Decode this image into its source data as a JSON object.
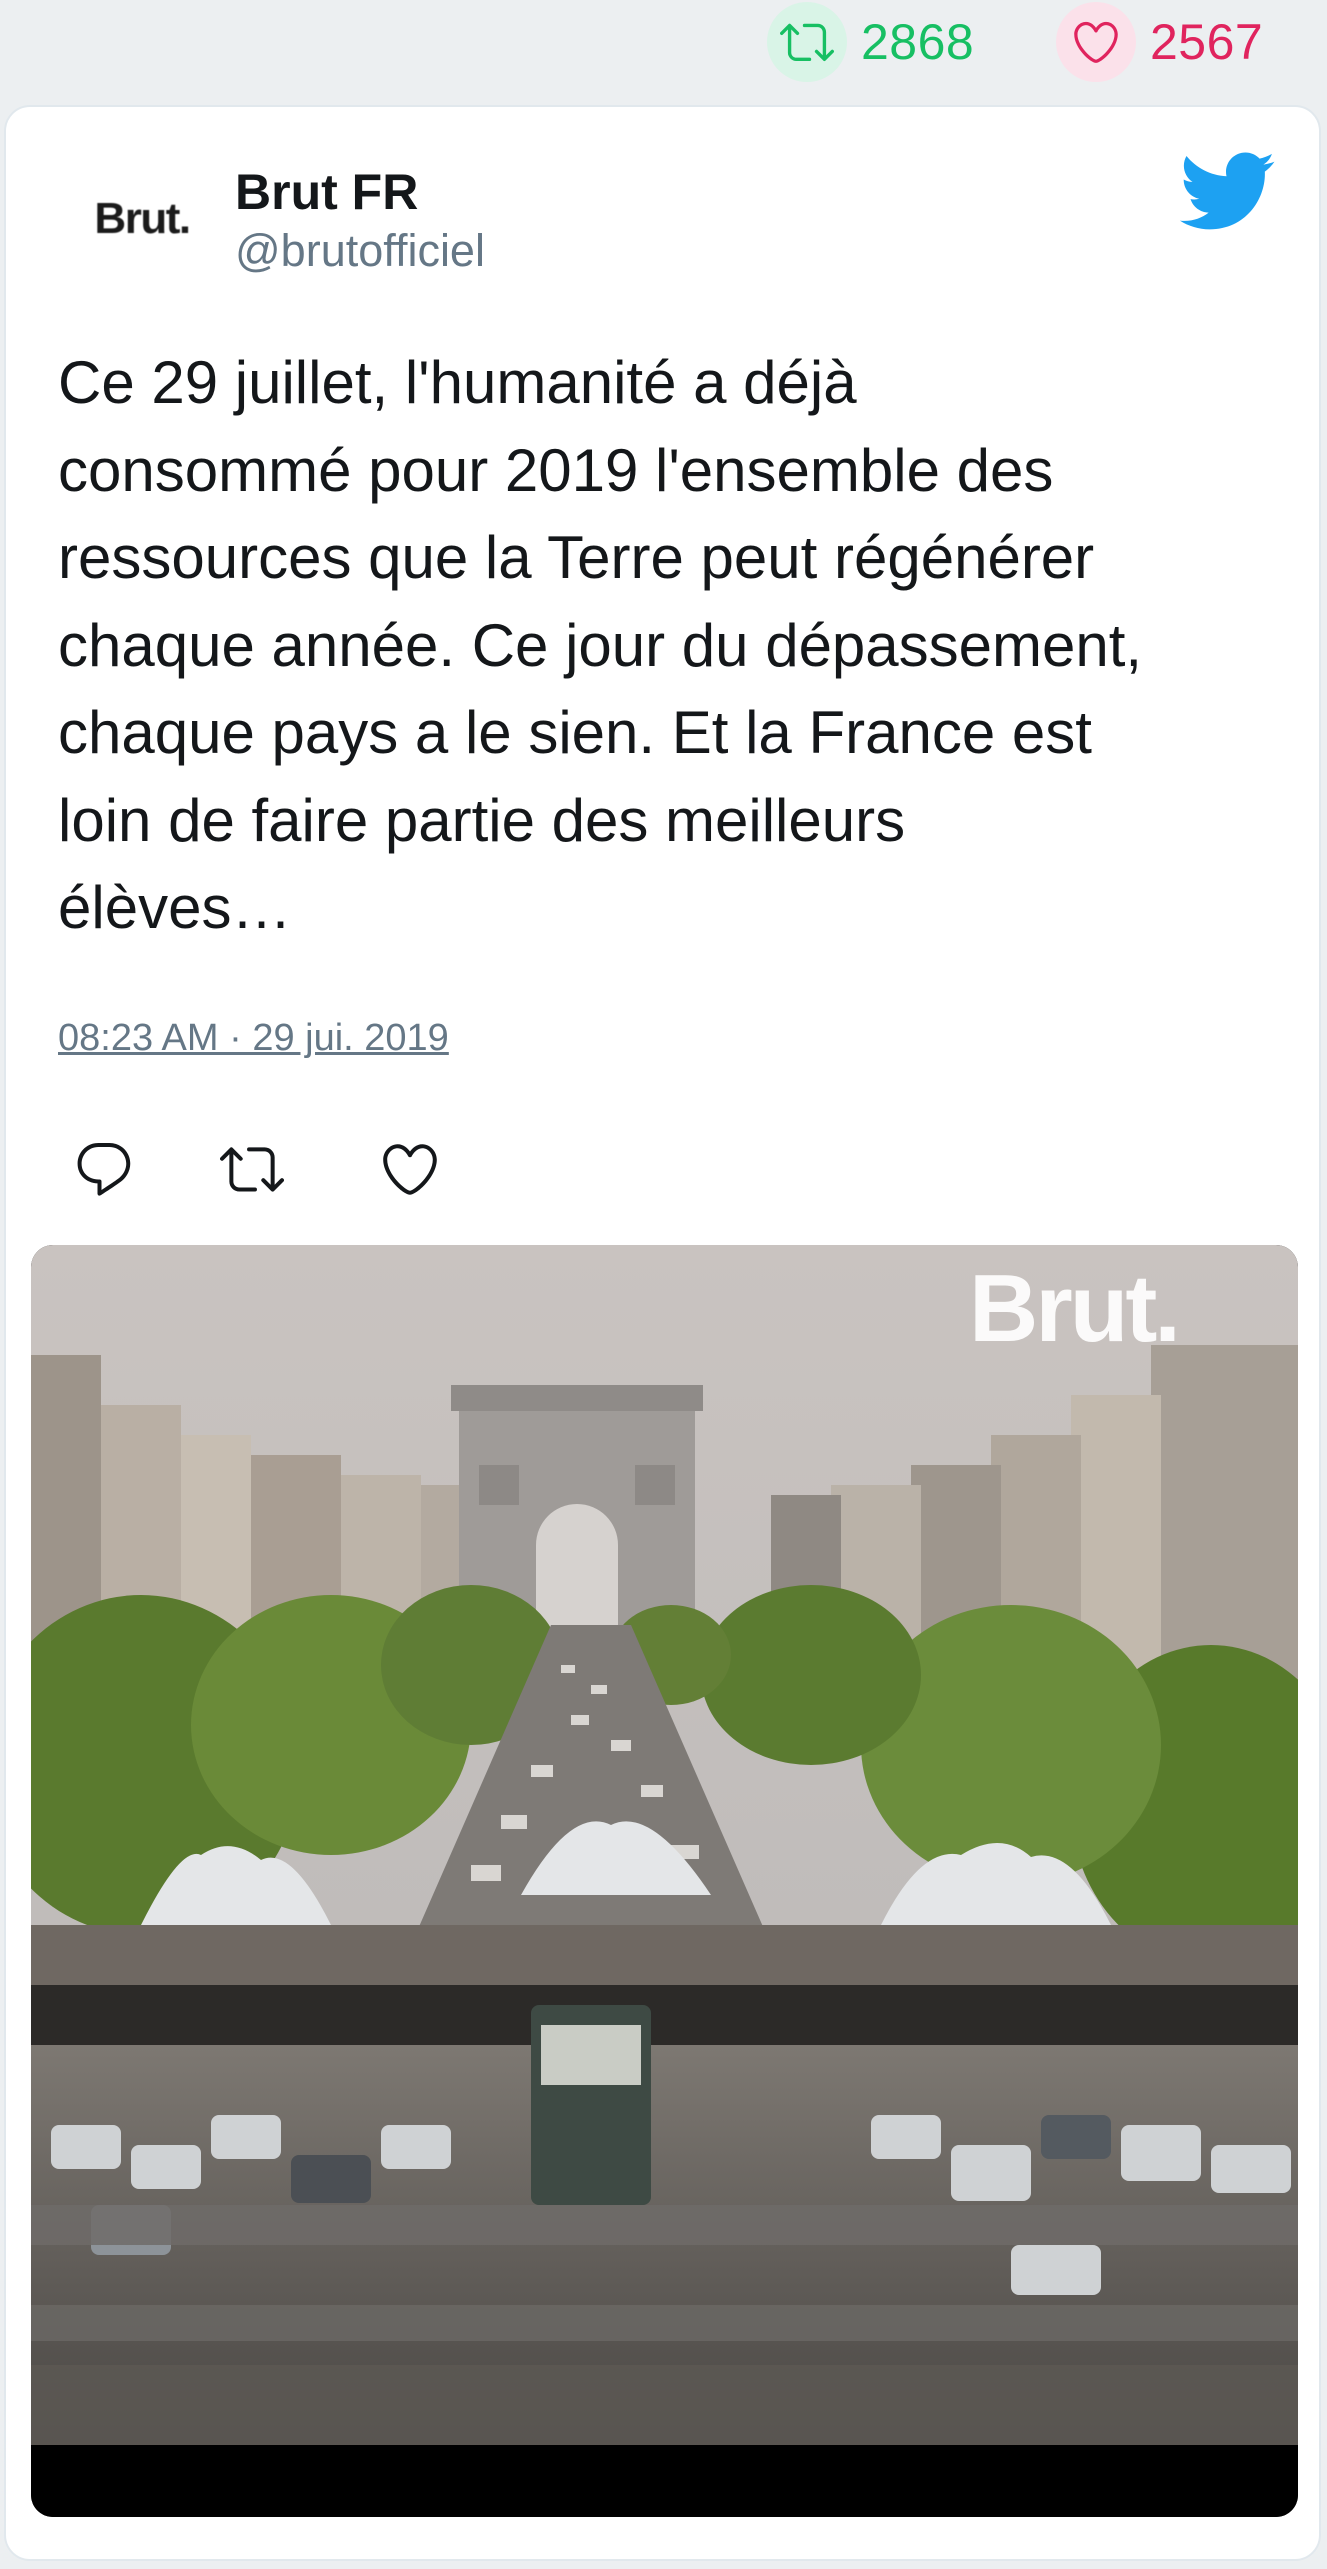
{
  "stats": {
    "retweets": "2868",
    "likes": "2567"
  },
  "tweet": {
    "author_name": "Brut FR",
    "author_handle": "@brutofficiel",
    "avatar_text": "Brut.",
    "text": "Ce 29 juillet, l'humanité a déjà\nconsommé pour 2019 l'ensemble des\nressources que la Terre peut régénérer\nchaque année. Ce jour du dépassement,\nchaque pays a le sien. Et la France est\nloin de faire partie des meilleurs\nélèves…",
    "timestamp": "08:23 AM · 29 jui. 2019"
  },
  "media": {
    "watermark": "Brut."
  },
  "icons": {
    "retweet_stat": "retweet-icon",
    "like_stat": "heart-icon",
    "brand": "twitter-bird-icon",
    "reply": "reply-icon",
    "retweet": "retweet-icon",
    "like": "heart-icon"
  },
  "colors": {
    "retweet": "#17bf63",
    "like": "#e0245e",
    "twitter_blue": "#1da1f2",
    "secondary_text": "#657786"
  }
}
